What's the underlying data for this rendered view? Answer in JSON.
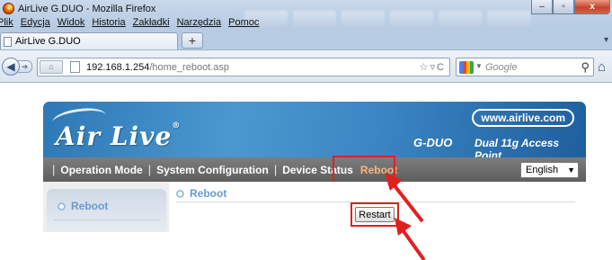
{
  "window": {
    "title": "AirLive G.DUO - Mozilla Firefox",
    "controls": [
      "minimize",
      "maximize",
      "close"
    ]
  },
  "menu": [
    "Plik",
    "Edycja",
    "Widok",
    "Historia",
    "Zakładki",
    "Narzędzia",
    "Pomoc"
  ],
  "tab": {
    "label": "AirLive G.DUO",
    "new_tab": "+"
  },
  "address": {
    "host": "192.168.1.254",
    "path": "/home_reboot.asp"
  },
  "search": {
    "placeholder": "Google"
  },
  "router": {
    "brand": "Air Live",
    "website": "www.airlive.com",
    "model": "G-DUO",
    "model_desc": "Dual 11g Access Point",
    "nav": [
      "Operation Mode",
      "System Configuration",
      "Device Status"
    ],
    "nav_active": "Reboot",
    "language": "English",
    "side_menu": {
      "item": "Reboot"
    },
    "panel": {
      "title": "Reboot",
      "button": "Restart"
    }
  },
  "annotation": {
    "highlight_color": "#e02020"
  }
}
